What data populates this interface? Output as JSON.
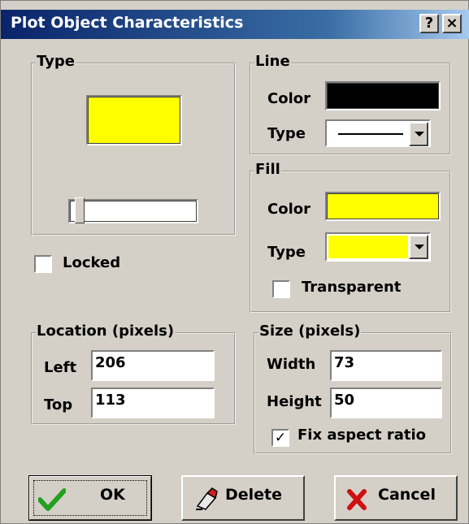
{
  "window": {
    "title": "Plot Object Characteristics",
    "help_label": "?",
    "close_label": "×"
  },
  "type_group": {
    "label": "Type",
    "preview_color": "#ffff00",
    "slider_level": 0.05
  },
  "locked": {
    "label": "Locked",
    "checked": false
  },
  "line_group": {
    "label": "Line",
    "color_label": "Color",
    "color_value": "#000000",
    "type_label": "Type"
  },
  "fill_group": {
    "label": "Fill",
    "color_label": "Color",
    "color_value": "#ffff00",
    "type_label": "Type",
    "type_value": "#ffff00",
    "transparent_label": "Transparent",
    "transparent_checked": false
  },
  "location_group": {
    "label": "Location (pixels)",
    "left_label": "Left",
    "left_value": "206",
    "top_label": "Top",
    "top_value": "113"
  },
  "size_group": {
    "label": "Size (pixels)",
    "width_label": "Width",
    "width_value": "73",
    "height_label": "Height",
    "height_value": "50",
    "fix_label": "Fix aspect ratio",
    "fix_checked": true
  },
  "buttons": {
    "ok": "OK",
    "delete": "Delete",
    "cancel": "Cancel"
  },
  "icons": {
    "ok": "checkmark-icon",
    "delete": "eraser-icon",
    "cancel": "x-icon"
  },
  "colors": {
    "ok_check": "#22a020",
    "cancel_x": "#d01010"
  }
}
